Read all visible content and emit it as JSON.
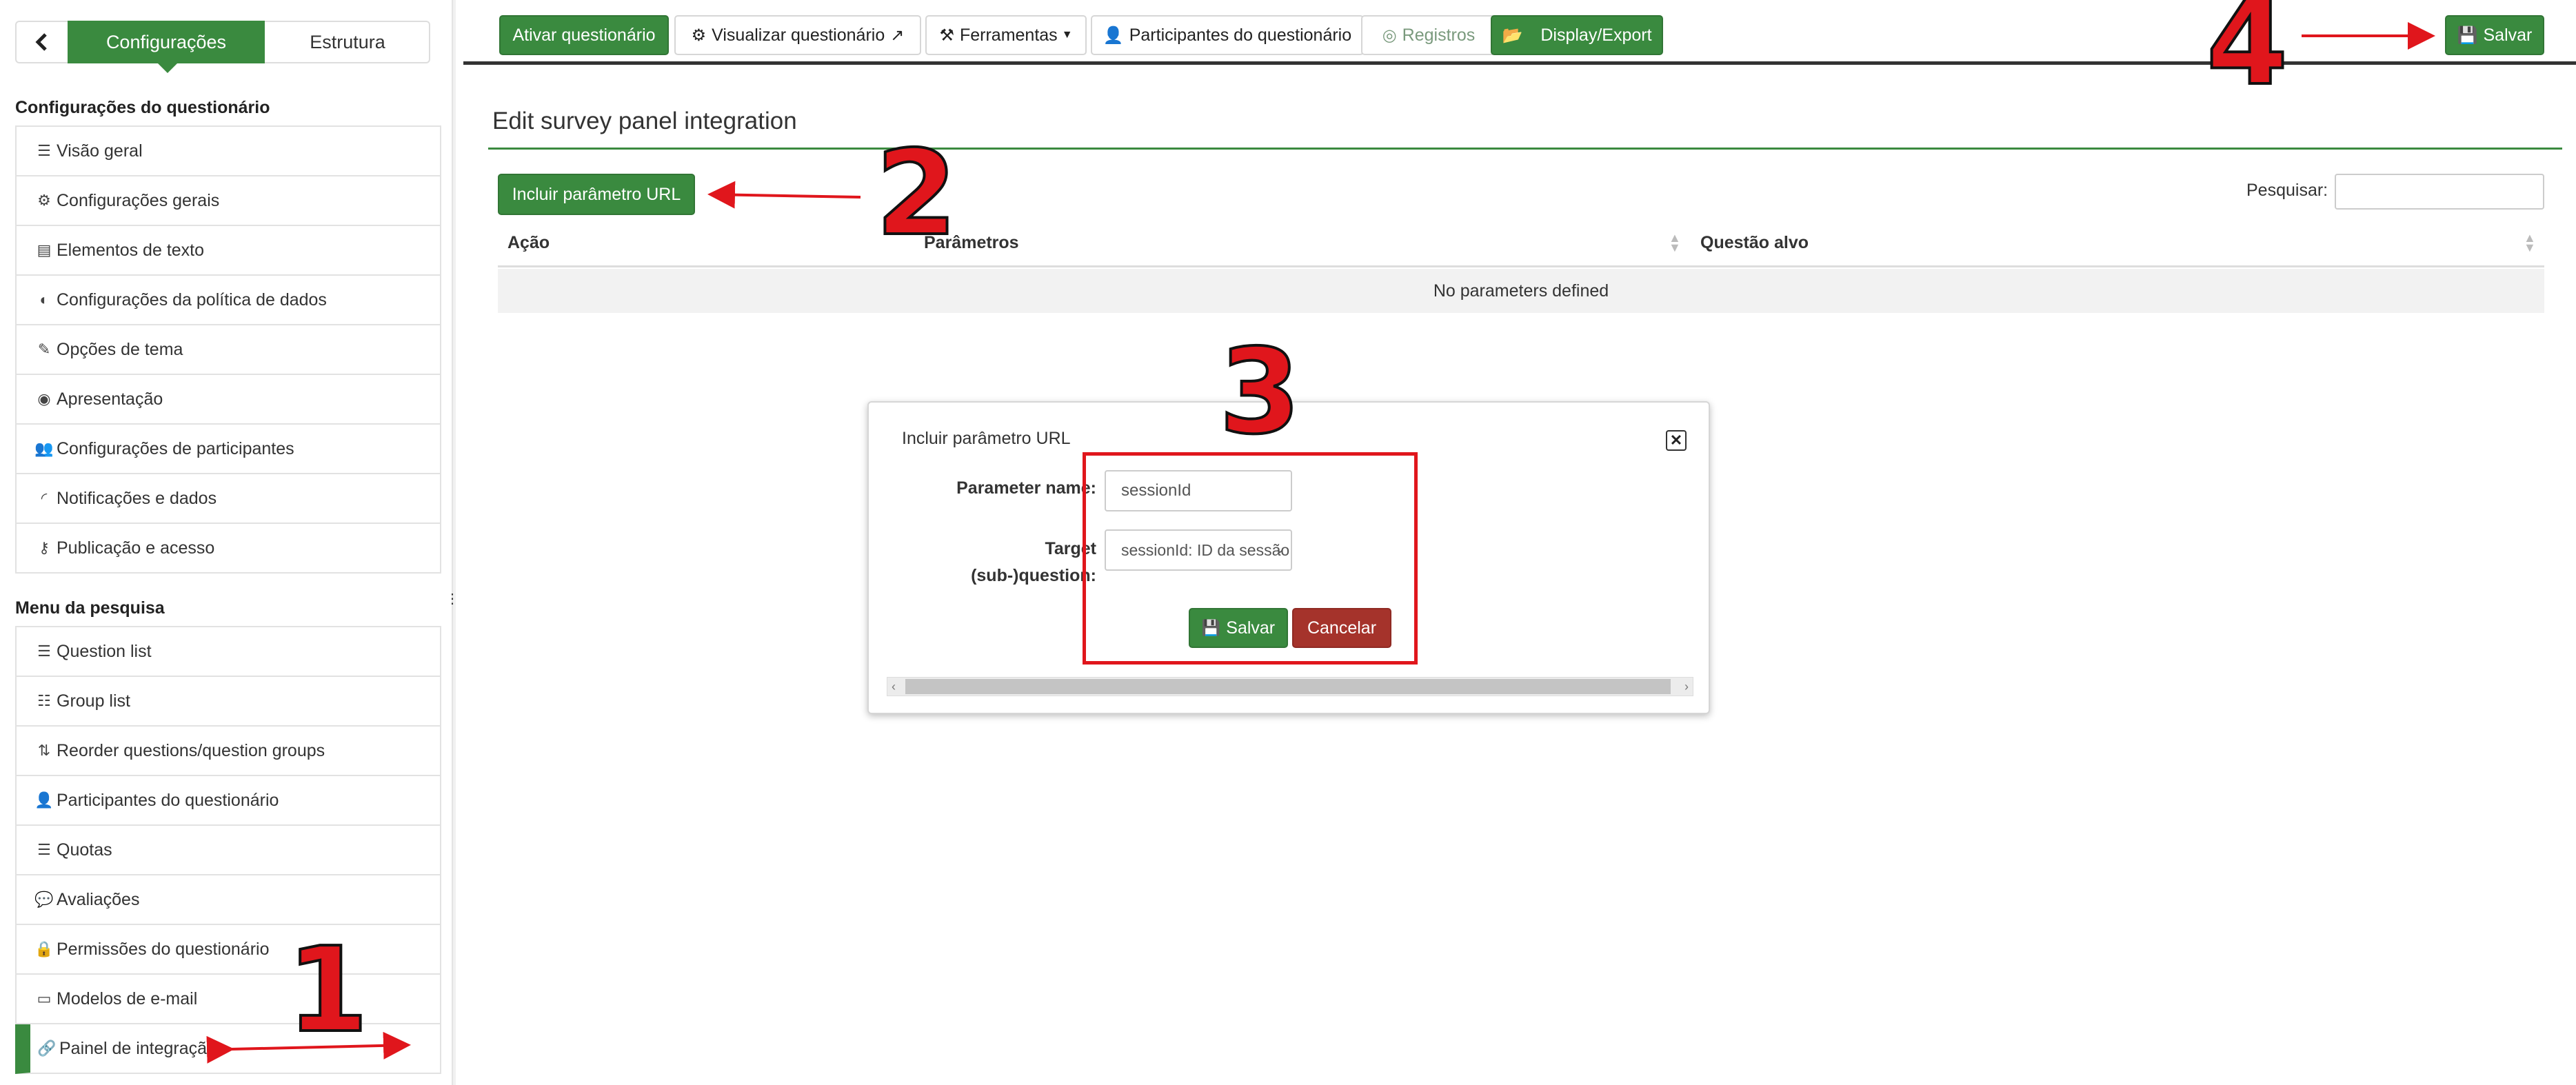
{
  "sidebar": {
    "tab_active": "Configurações",
    "tab_other": "Estrutura",
    "section1_title": "Configurações do questionário",
    "section1_items": [
      {
        "label": "Visão geral",
        "icon": "list-icon"
      },
      {
        "label": "Configurações gerais",
        "icon": "gears-icon"
      },
      {
        "label": "Elementos de texto",
        "icon": "file-text-icon"
      },
      {
        "label": "Configurações da política de dados",
        "icon": "shield-icon"
      },
      {
        "label": "Opções de tema",
        "icon": "paintbrush-icon"
      },
      {
        "label": "Apresentação",
        "icon": "eye-slash-icon"
      },
      {
        "label": "Configurações de participantes",
        "icon": "users-icon"
      },
      {
        "label": "Notificações e dados",
        "icon": "rss-icon"
      },
      {
        "label": "Publicação e acesso",
        "icon": "key-icon"
      }
    ],
    "section2_title": "Menu da pesquisa",
    "section2_items": [
      {
        "label": "Question list",
        "icon": "list-icon"
      },
      {
        "label": "Group list",
        "icon": "th-list-icon"
      },
      {
        "label": "Reorder questions/question groups",
        "icon": "sort-icon"
      },
      {
        "label": "Participantes do questionário",
        "icon": "user-icon"
      },
      {
        "label": "Quotas",
        "icon": "tasks-icon"
      },
      {
        "label": "Avaliações",
        "icon": "comment-icon"
      },
      {
        "label": "Permissões do questionário",
        "icon": "lock-icon"
      },
      {
        "label": "Modelos de e-mail",
        "icon": "window-icon"
      },
      {
        "label": "Painel de integração",
        "icon": "link-icon",
        "active": true
      }
    ]
  },
  "toolbar": {
    "activate": "Ativar questionário",
    "preview": "Visualizar questionário",
    "tools": "Ferramentas",
    "participants": "Participantes do questionário",
    "responses": "Registros",
    "display_export": "Display/Export",
    "save": "Salvar"
  },
  "main": {
    "title": "Edit survey panel integration",
    "add_param_button": "Incluir parâmetro URL",
    "search_label": "Pesquisar:",
    "columns": [
      "Ação",
      "Parâmetros",
      "Questão alvo"
    ],
    "empty_message": "No parameters defined"
  },
  "modal": {
    "title": "Incluir parâmetro URL",
    "param_name_label": "Parameter name:",
    "param_name_value": "sessionId",
    "target_label_line1": "Target",
    "target_label_line2": "(sub-)question:",
    "target_value": "sessionId: ID da sessão",
    "save": "Salvar",
    "cancel": "Cancelar"
  },
  "annotations": {
    "step1": "1",
    "step2": "2",
    "step3": "3",
    "step4": "4",
    "color": "#e0161c"
  },
  "colors": {
    "primary": "#3a8a3f",
    "danger": "#a5332b"
  }
}
